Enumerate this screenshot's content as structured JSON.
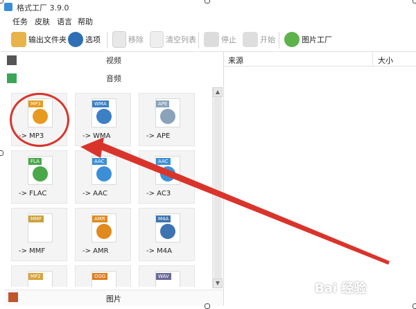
{
  "window": {
    "title": "格式工厂 3.9.0"
  },
  "menu": [
    "任务",
    "皮肤",
    "语言",
    "帮助"
  ],
  "toolbar": {
    "output_folder": "输出文件夹",
    "options": "选项",
    "remove": "移除",
    "clear_list": "清空列表",
    "stop": "停止",
    "start": "开始",
    "picture_factory": "图片工厂"
  },
  "categories": {
    "video": "视频",
    "audio": "音频",
    "picture": "图片"
  },
  "tiles": [
    {
      "badge": "MP3",
      "label": "-> MP3",
      "color": "#e79a1f"
    },
    {
      "badge": "WMA",
      "label": "-> WMA",
      "color": "#3b7fc4"
    },
    {
      "badge": "APE",
      "label": "-> APE",
      "color": "#8aa3b8"
    },
    {
      "badge": "FLA",
      "label": "-> FLAC",
      "color": "#4aa84a"
    },
    {
      "badge": "AAC",
      "label": "-> AAC",
      "color": "#3c8fd6"
    },
    {
      "badge": "AAC",
      "label": "-> AC3",
      "color": "#3c8fd6"
    },
    {
      "badge": "MMF",
      "label": "-> MMF",
      "color": "#c9a23a"
    },
    {
      "badge": "AMR",
      "label": "-> AMR",
      "color": "#e08a1e"
    },
    {
      "badge": "M4A",
      "label": "-> M4A",
      "color": "#3d73b0"
    },
    {
      "badge": "MP2",
      "label": "",
      "color": "#d9a23b"
    },
    {
      "badge": "OGG",
      "label": "",
      "color": "#e07c20"
    },
    {
      "badge": "WAV",
      "label": "",
      "color": "#6a6a9a"
    }
  ],
  "file_list": {
    "columns": [
      "来源",
      "大小"
    ]
  },
  "watermark": "Bai 经验",
  "colors": {
    "annotation_red": "#d9342b",
    "accent_blue": "#3a8ed8"
  }
}
